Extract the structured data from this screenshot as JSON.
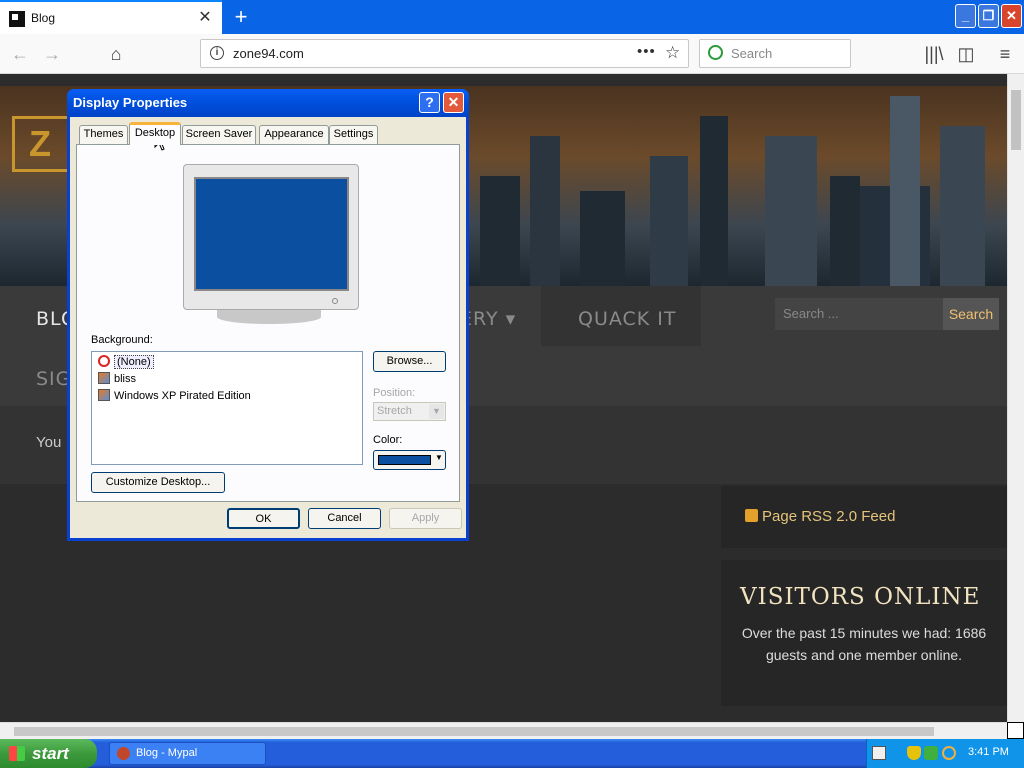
{
  "browser": {
    "tab_title": "Blog",
    "tab_close": "✕",
    "new_tab": "+",
    "url": "zone94.com",
    "url_info_icon": "i",
    "page_actions": "•••",
    "bookmark_star": "☆",
    "search_placeholder": "Search",
    "back": "←",
    "forward": "→",
    "home": "⌂",
    "library": "|||\\",
    "sidebar": "◫",
    "menu": "≡",
    "window_min": "_",
    "window_max": "❐",
    "window_close": "✕"
  },
  "site": {
    "logo": "Z",
    "menu_blog": "BLO",
    "menu_sign": "SIG",
    "menu_gallery": "ERY ▾",
    "menu_quack": "QUACK IT",
    "search_placeholder": "Search ...",
    "search_button": "Search",
    "welcome_partial": "You",
    "rss_feed": "Page RSS 2.0 Feed",
    "visitors_title": "VISITORS ONLINE",
    "visitors_desc": "Over the past 15 minutes we had: 1686 guests and one member online."
  },
  "dialog": {
    "title": "Display Properties",
    "help": "?",
    "close": "✕",
    "tabs": [
      "Themes",
      "Desktop",
      "Screen Saver",
      "Appearance",
      "Settings"
    ],
    "active_tab": "Desktop",
    "background_label": "Background:",
    "background_items": [
      "(None)",
      "bliss",
      "Windows XP Pirated Edition"
    ],
    "selected_background": "(None)",
    "browse_button": "Browse...",
    "position_label": "Position:",
    "position_value": "Stretch",
    "color_label": "Color:",
    "color_value": "#0b4fa0",
    "customize_button": "Customize Desktop...",
    "ok_button": "OK",
    "cancel_button": "Cancel",
    "apply_button": "Apply"
  },
  "taskbar": {
    "start": "start",
    "task_item": "Blog - Mypal",
    "clock": "3:41 PM"
  },
  "colors": {
    "xp_blue": "#0a5ef5",
    "dialog_face": "#ece9d8",
    "desktop_color": "#0b4fa0",
    "accent_gold": "#e5c47a"
  }
}
